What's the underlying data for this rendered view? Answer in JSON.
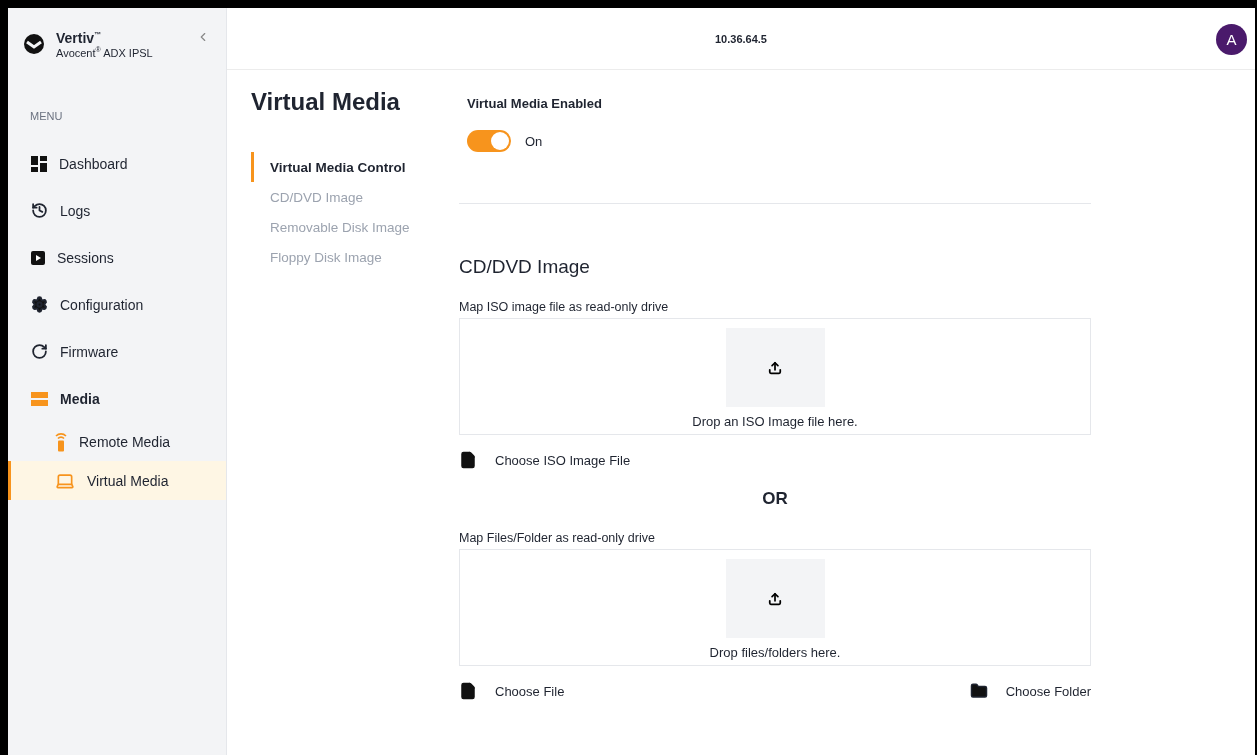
{
  "sidebar": {
    "brand": "Vertiv$^{™}$",
    "product": "Avocent$^{®}$ ADX IPSL",
    "menu_label": "MENU",
    "items": [
      {
        "label": "Dashboard",
        "selected": false
      },
      {
        "label": "Logs",
        "selected": false
      },
      {
        "label": "Sessions",
        "selected": false
      },
      {
        "label": "Configuration",
        "selected": false
      },
      {
        "label": "Firmware",
        "selected": false
      },
      {
        "label": "Media",
        "selected": true,
        "expanded": true,
        "children": [
          {
            "label": "Remote Media",
            "selected": false
          },
          {
            "label": "Virtual Media",
            "selected": true
          }
        ]
      }
    ]
  },
  "header": {
    "address": "10.36.64.5",
    "avatar": "A"
  },
  "page": {
    "title": "Virtual Media",
    "sections_nav": [
      {
        "label": "Virtual Media Control",
        "selected": true
      },
      {
        "label": "CD/DVD Image",
        "selected": false
      },
      {
        "label": "Removable Disk Image",
        "selected": false
      },
      {
        "label": "Floppy Disk Image",
        "selected": false
      }
    ],
    "enabled": {
      "label": "Virtual Media Enabled",
      "on": true,
      "state_text": "On"
    },
    "cd_dvd": {
      "title": "CD/DVD Image",
      "uploads": [
        {
          "label": "Map ISO image file as read-only drive",
          "drop_text": "Drop an ISO Image file here.",
          "buttons": [
            {
              "kind": "file",
              "label": "Choose ISO Image File"
            }
          ]
        },
        {
          "label": "Map Files/Folder as read-only drive",
          "drop_text": "Drop files/folders here.",
          "buttons": [
            {
              "kind": "file",
              "label": "Choose File"
            },
            {
              "kind": "folder",
              "label": "Choose Folder"
            }
          ]
        }
      ],
      "separator": "OR"
    }
  }
}
